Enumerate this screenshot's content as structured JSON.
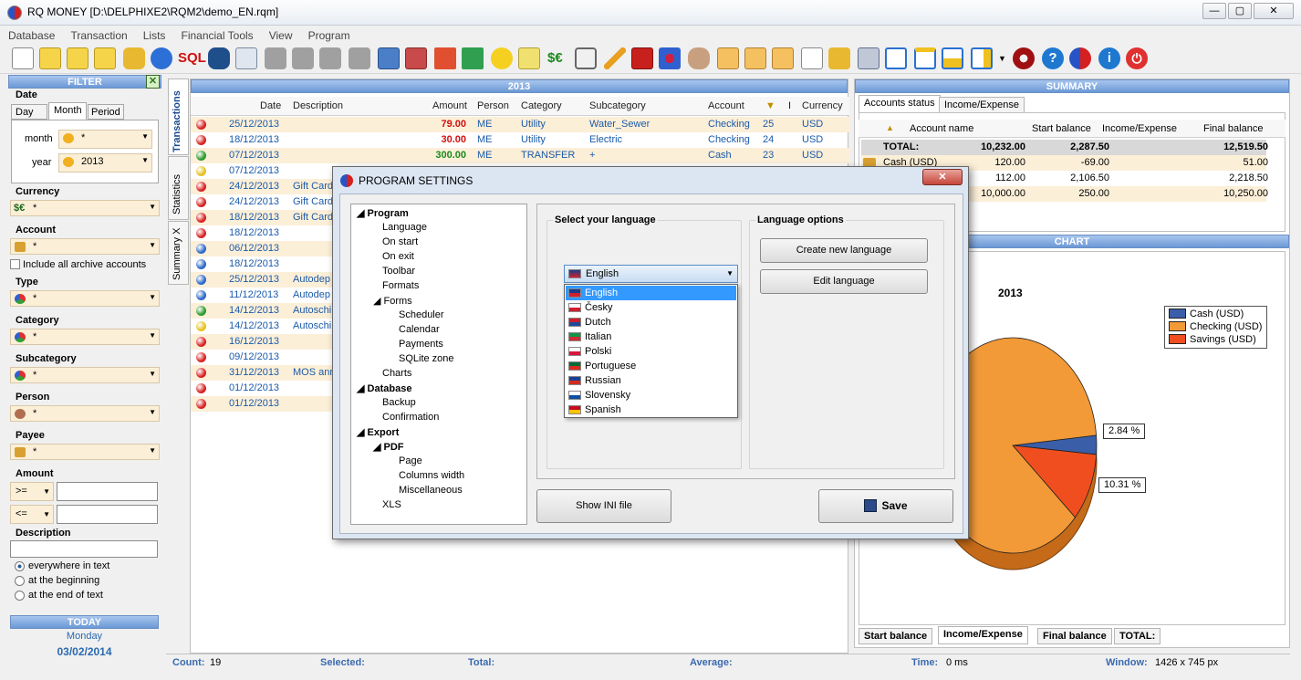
{
  "window": {
    "title": "RQ MONEY [D:\\DELPHIXE2\\RQM2\\demo_EN.rqm]",
    "min": "—",
    "max": "▢",
    "close": "✕"
  },
  "menu": [
    "Database",
    "Transaction",
    "Lists",
    "Financial Tools",
    "View",
    "Program"
  ],
  "toolbar": {
    "sql_label": "SQL"
  },
  "filter": {
    "title": "FILTER",
    "date_label": "Date",
    "date_tabs": [
      "Day",
      "Month",
      "Period"
    ],
    "month_label": "month",
    "month_value": "*",
    "year_label": "year",
    "year_value": "2013",
    "currency_label": "Currency",
    "currency_value": "*",
    "currency_icon": "$€",
    "account_label": "Account",
    "account_value": "*",
    "archive_label": "Include all archive accounts",
    "type_label": "Type",
    "type_value": "*",
    "category_label": "Category",
    "category_value": "*",
    "subcategory_label": "Subcategory",
    "subcategory_value": "*",
    "person_label": "Person",
    "person_value": "*",
    "payee_label": "Payee",
    "payee_value": "*",
    "amount_label": "Amount",
    "amount_op1": ">=",
    "amount_op2": "<=",
    "description_label": "Description",
    "desc_options": [
      "everywhere in text",
      "at the beginning",
      "at the end of text"
    ],
    "today_title": "TODAY",
    "today_day": "Monday",
    "today_date": "03/02/2014"
  },
  "side_tabs": [
    "Transactions",
    "Statistics",
    "Summary X"
  ],
  "transactions": {
    "year": "2013",
    "columns": [
      "Date",
      "Description",
      "Amount",
      "Person",
      "Category",
      "Subcategory",
      "Account",
      "I",
      "Currency"
    ],
    "rows": [
      {
        "status": "red",
        "date": "25/12/2013",
        "desc": "",
        "amount": "79.00",
        "amount_color": "#d01010",
        "person": "ME",
        "category": "Utility",
        "subcategory": "Water_Sewer",
        "account": "Checking",
        "id": "25",
        "currency": "USD"
      },
      {
        "status": "red",
        "date": "18/12/2013",
        "desc": "",
        "amount": "30.00",
        "amount_color": "#d01010",
        "person": "ME",
        "category": "Utility",
        "subcategory": "Electric",
        "account": "Checking",
        "id": "24",
        "currency": "USD"
      },
      {
        "status": "green",
        "date": "07/12/2013",
        "desc": "",
        "amount": "300.00",
        "amount_color": "#1a8a1a",
        "person": "ME",
        "category": "TRANSFER",
        "subcategory": "+",
        "account": "Cash",
        "id": "23",
        "currency": "USD"
      },
      {
        "status": "yellow",
        "date": "07/12/2013",
        "desc": ""
      },
      {
        "status": "red",
        "date": "24/12/2013",
        "desc": "Gift Card"
      },
      {
        "status": "red",
        "date": "24/12/2013",
        "desc": "Gift Card"
      },
      {
        "status": "red",
        "date": "18/12/2013",
        "desc": "Gift Card"
      },
      {
        "status": "red",
        "date": "18/12/2013",
        "desc": ""
      },
      {
        "status": "blue",
        "date": "06/12/2013",
        "desc": ""
      },
      {
        "status": "blue",
        "date": "18/12/2013",
        "desc": ""
      },
      {
        "status": "blue",
        "date": "25/12/2013",
        "desc": "Autodep"
      },
      {
        "status": "blue",
        "date": "11/12/2013",
        "desc": "Autodep"
      },
      {
        "status": "green",
        "date": "14/12/2013",
        "desc": "Autoschi"
      },
      {
        "status": "yellow",
        "date": "14/12/2013",
        "desc": "Autoschi"
      },
      {
        "status": "red",
        "date": "16/12/2013",
        "desc": ""
      },
      {
        "status": "red",
        "date": "09/12/2013",
        "desc": ""
      },
      {
        "status": "red",
        "date": "31/12/2013",
        "desc": "MOS ann"
      },
      {
        "status": "red",
        "date": "01/12/2013",
        "desc": ""
      },
      {
        "status": "red",
        "date": "01/12/2013",
        "desc": ""
      }
    ]
  },
  "summary": {
    "title": "SUMMARY",
    "tabs": [
      "Accounts status",
      "Income/Expense"
    ],
    "columns": [
      "Account name",
      "Start balance",
      "Income/Expense",
      "Final balance"
    ],
    "total": {
      "name": "TOTAL:",
      "start": "10,232.00",
      "income": "2,287.50",
      "final": "12,519.50"
    },
    "rows": [
      {
        "name": "Cash (USD)",
        "start": "120.00",
        "income": "-69.00",
        "final": "51.00"
      },
      {
        "name": "",
        "start": "112.00",
        "income": "2,106.50",
        "final": "2,218.50"
      },
      {
        "name": "",
        "start": "10,000.00",
        "income": "250.00",
        "final": "10,250.00"
      }
    ]
  },
  "chart_data": {
    "type": "pie",
    "title": "2013",
    "categories": [
      "Cash (USD)",
      "Checking (USD)",
      "Savings (USD)"
    ],
    "values": [
      2.84,
      86.85,
      10.31
    ],
    "colors": [
      "#3a5ea8",
      "#f29a38",
      "#f04e1e"
    ],
    "data_labels": [
      "2.84 %",
      "",
      "10.31 %"
    ],
    "legend": "top-right"
  },
  "chart_panel": {
    "title": "CHART",
    "bottom_tabs": [
      "Start balance",
      "Income/Expense",
      "Final balance",
      "TOTAL:"
    ]
  },
  "status": {
    "count_label": "Count:",
    "count": "19",
    "selected_label": "Selected:",
    "total_label": "Total:",
    "average_label": "Average:",
    "time_label": "Time:",
    "time": "0 ms",
    "window_label": "Window:",
    "window": "1426 x 745 px"
  },
  "dialog": {
    "title": "PROGRAM SETTINGS",
    "close": "✕",
    "tree": [
      {
        "label": "Program",
        "bold": true,
        "level": 0,
        "exp": true
      },
      {
        "label": "Language",
        "level": 1
      },
      {
        "label": "On start",
        "level": 1
      },
      {
        "label": "On exit",
        "level": 1
      },
      {
        "label": "Toolbar",
        "level": 1
      },
      {
        "label": "Formats",
        "level": 1
      },
      {
        "label": "Forms",
        "level": 1,
        "exp": true
      },
      {
        "label": "Scheduler",
        "level": 2
      },
      {
        "label": "Calendar",
        "level": 2
      },
      {
        "label": "Payments",
        "level": 2
      },
      {
        "label": "SQLite zone",
        "level": 2
      },
      {
        "label": "Charts",
        "level": 1
      },
      {
        "label": "Database",
        "bold": true,
        "level": 0,
        "exp": true
      },
      {
        "label": "Backup",
        "level": 1
      },
      {
        "label": "Confirmation",
        "level": 1
      },
      {
        "label": "Export",
        "bold": true,
        "level": 0,
        "exp": true
      },
      {
        "label": "PDF",
        "bold": true,
        "level": 1,
        "exp": true
      },
      {
        "label": "Page",
        "level": 2
      },
      {
        "label": "Columns width",
        "level": 2
      },
      {
        "label": "Miscellaneous",
        "level": 2
      },
      {
        "label": "XLS",
        "level": 1
      }
    ],
    "select_lang_title": "Select your language",
    "selected_language": "English",
    "languages": [
      {
        "name": "English",
        "flag": [
          "#1a3a8a",
          "#d21f2f"
        ]
      },
      {
        "name": "Česky",
        "flag": [
          "#ffffff",
          "#d21f2f"
        ]
      },
      {
        "name": "Dutch",
        "flag": [
          "#c8202a",
          "#1d4a9a"
        ]
      },
      {
        "name": "Italian",
        "flag": [
          "#139445",
          "#ce2b37"
        ]
      },
      {
        "name": "Polski",
        "flag": [
          "#ffffff",
          "#dc143c"
        ]
      },
      {
        "name": "Portuguese",
        "flag": [
          "#046a38",
          "#da291c"
        ]
      },
      {
        "name": "Russian",
        "flag": [
          "#1c3f95",
          "#d52b1e"
        ]
      },
      {
        "name": "Slovensky",
        "flag": [
          "#ffffff",
          "#0b4ea2"
        ]
      },
      {
        "name": "Spanish",
        "flag": [
          "#c60b1e",
          "#ffc400"
        ]
      }
    ],
    "lang_options_title": "Language options",
    "create_btn": "Create new language",
    "edit_btn": "Edit language",
    "show_ini_btn": "Show INI file",
    "save_btn": "Save"
  }
}
